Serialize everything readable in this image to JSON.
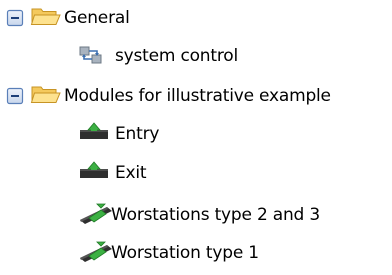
{
  "tree": {
    "groups": [
      {
        "label": "General",
        "expanded": true,
        "icon": "folder-open-icon",
        "children": [
          {
            "label": "system control",
            "icon": "system-control-icon"
          }
        ]
      },
      {
        "label": "Modules for illustrative example",
        "expanded": true,
        "icon": "folder-open-icon",
        "children": [
          {
            "label": "Entry",
            "icon": "entry-module-icon"
          },
          {
            "label": "Exit",
            "icon": "exit-module-icon"
          },
          {
            "label": "Worstations type 2 and 3",
            "icon": "workstation-icon"
          },
          {
            "label": "Worstation type 1",
            "icon": "workstation-icon"
          }
        ]
      }
    ]
  }
}
